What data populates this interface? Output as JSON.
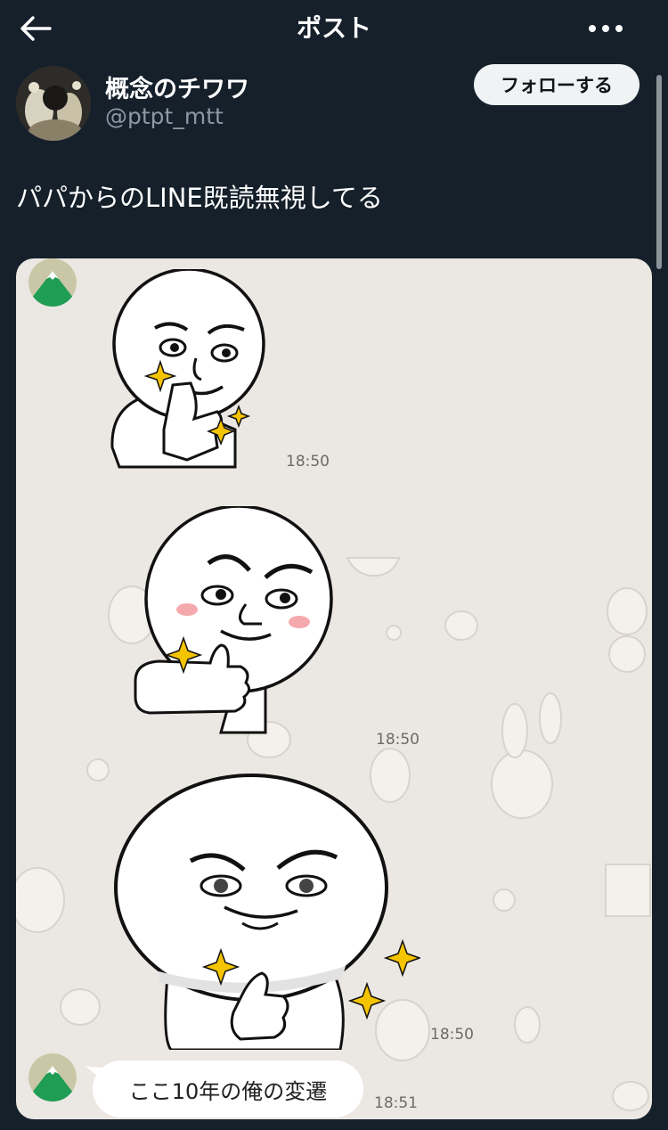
{
  "header": {
    "title": "ポスト"
  },
  "author": {
    "display_name": "概念のチワワ",
    "handle": "@ptpt_mtt",
    "follow_label": "フォローする"
  },
  "post": {
    "text": "パパからのLINE既読無視してる"
  },
  "chat": {
    "times": [
      "18:50",
      "18:50",
      "18:50",
      "18:51"
    ],
    "message": "ここ10年の俺の変遷"
  },
  "icons": [
    "back-arrow-icon",
    "more-dots-icon",
    "mountain-avatar-icon",
    "sparkle-icon"
  ],
  "colors": {
    "background": "#15202b",
    "chat_bg": "#ebe7e2",
    "follow_btn": "#eff3f4",
    "handle": "#8b98a5",
    "sparkle": "#f5c400",
    "blush": "#f6a9ad",
    "mountain_green": "#1f9d55"
  }
}
